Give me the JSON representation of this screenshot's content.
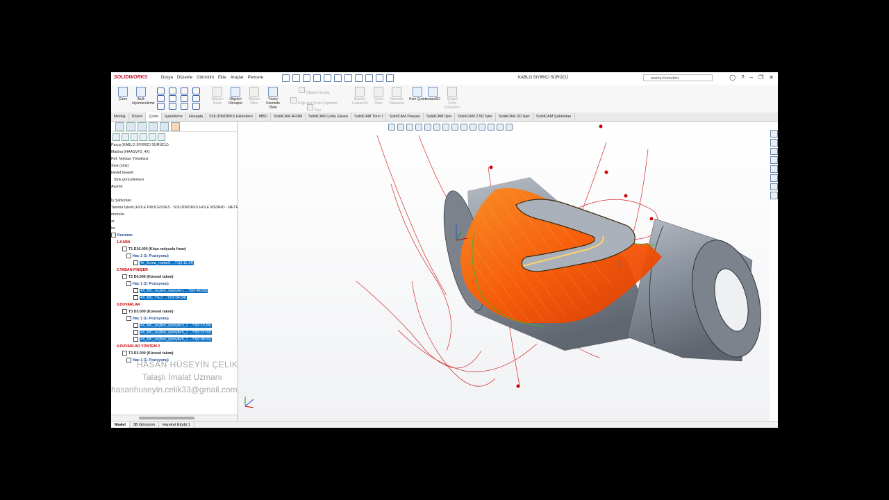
{
  "app": {
    "brand": "SOLIDWORKS",
    "document_title": "KABLO SIYIRICI SÜRÜCÜ",
    "search_placeholder": "arama Komutları",
    "menu": [
      "Dosya",
      "Düzenle",
      "Görünüm",
      "Ekle",
      "Araçlar",
      "Pencere"
    ]
  },
  "ribbon": {
    "items": [
      {
        "label": "Çizim",
        "enabled": true
      },
      {
        "label": "Akıllı ölçümlendirme",
        "enabled": true
      },
      {
        "label": "Objeleri Buda",
        "enabled": false
      },
      {
        "label": "Objeleri Dönüştür",
        "enabled": true
      },
      {
        "label": "Objeleri Ötele",
        "enabled": false
      },
      {
        "label": "Yüzey Üzerinde Ötele",
        "enabled": true
      },
      {
        "label": "Objeleri Aynala",
        "enabled": false
      },
      {
        "label": "Doğrusal Çizim Çoğaltma",
        "enabled": false
      },
      {
        "label": "Taşı",
        "enabled": false
      },
      {
        "label": "İlişkileri Göster/Sil",
        "enabled": false
      },
      {
        "label": "Çizimi Onar",
        "enabled": false
      },
      {
        "label": "Otomatik Yakalama",
        "enabled": false
      },
      {
        "label": "Hızlı Çizim",
        "enabled": true
      },
      {
        "label": "Instant2D",
        "enabled": true
      },
      {
        "label": "Gölgeli Çizim Konturları",
        "enabled": false
      }
    ]
  },
  "tabs": [
    "Montaj",
    "Düzen",
    "Çizim",
    "İşaretleme",
    "Hesapla",
    "SOLIDWORKS Eklentileri",
    "MBD",
    "SolidCAM AFRM",
    "SolidCAM Çoklu Eksen",
    "SolidCAM Tornा",
    "SolidCAM Parçası",
    "SolidCAM İşler",
    "SolidCAM 2.5D İşler",
    "SolidCAM 3D İşler",
    "SolidCAM Şablonları"
  ],
  "active_tab": "Çizim",
  "tree": [
    {
      "text": "Parça (KABLO SIYIRICI SÜRÜCÜ)",
      "style": "",
      "indent": 0
    },
    {
      "text": "Makina (HAASVF3_4X)",
      "style": "",
      "indent": 0
    },
    {
      "text": "Ref. Noktası Yöneticisi",
      "style": "",
      "indent": 0
    },
    {
      "text": "Stok (stok)",
      "style": "",
      "indent": 0
    },
    {
      "text": "Hedef (hedef)",
      "style": "",
      "indent": 0
    },
    {
      "text": "Stok güncellemesi",
      "style": "",
      "indent": 4
    },
    {
      "text": "Ayarlar",
      "style": "",
      "indent": 0
    },
    {
      "text": "",
      "style": "",
      "indent": 0
    },
    {
      "text": "İş Şablonları",
      "style": "",
      "indent": 0
    },
    {
      "text": "Tanıma İşlemi (HOLE PROCESSES - SOLIDWORKS HOLE WIZARD - METRIC)",
      "style": "",
      "indent": 0
    },
    {
      "text": "metreler",
      "style": "",
      "indent": 0
    },
    {
      "text": "ar",
      "style": "",
      "indent": 0
    },
    {
      "text": "ler",
      "style": "",
      "indent": 0
    },
    {
      "text": "Kurulum",
      "style": "blue",
      "indent": 0
    },
    {
      "text": "1.KABA",
      "style": "red",
      "indent": 8
    },
    {
      "text": "T1 D10.000  (Köşe radyuslu freze)",
      "style": "bold",
      "indent": 16
    },
    {
      "text": "Hac 1 (1- Pozisyonu)",
      "style": "blue",
      "indent": 22
    },
    {
      "text": "4x_Screw_model1 ...T1(0:11:14)",
      "style": "sel",
      "indent": 32
    },
    {
      "text": "2.TABAN FİNİŞER",
      "style": "red",
      "indent": 8
    },
    {
      "text": "T2 D6.000  (Küresel takım)",
      "style": "bold",
      "indent": 16
    },
    {
      "text": "Hac 1 (1- Pozisyonu)",
      "style": "blue",
      "indent": 22
    },
    {
      "text": "4X_MC_seçilen_yüzeyler1 ...T2(0:46:59)",
      "style": "sel",
      "indent": 32
    },
    {
      "text": "4X_MC_Yüz1 ...T2(0:04:34)",
      "style": "sel",
      "indent": 32
    },
    {
      "text": "3.DUVARLAR",
      "style": "red",
      "indent": 8
    },
    {
      "text": "T3 D3.000  (Küresel takım)",
      "style": "bold",
      "indent": 16
    },
    {
      "text": "Hac 1 (1- Pozisyonu)",
      "style": "blue",
      "indent": 22
    },
    {
      "text": "4X_MC_seçilen_yüzeyler3_1 ...T3(0:19:24)",
      "style": "sel",
      "indent": 32
    },
    {
      "text": "4X_MC_seçilen_yüzeyler5_1 ...T3(0:22:09)",
      "style": "sel",
      "indent": 32
    },
    {
      "text": "4X_MC_seçilen_yüzeyler6_1 ...T3(0:08:03)",
      "style": "sel",
      "indent": 32
    },
    {
      "text": "4.DUVARLAR YÖNTEM 2",
      "style": "red",
      "indent": 8
    },
    {
      "text": "T3 D3.000  (Küresel takım)",
      "style": "bold",
      "indent": 16
    },
    {
      "text": "Hac 1 (1- Pozisyonu)",
      "style": "blue",
      "indent": 22
    },
    {
      "text": "",
      "style": "",
      "indent": 32
    },
    {
      "text": "",
      "style": "",
      "indent": 32
    }
  ],
  "bottom_tabs": [
    "Model",
    "3B Görünüm",
    "Hareket Etüdü 1"
  ],
  "active_bottom_tab": "Model",
  "watermark": {
    "name": "HASAN HÜSEYİN ÇELİK",
    "title": "Talaşlı İmalat Uzmanı",
    "email": "hasanhuseyin.celik33@gmail.com"
  },
  "colors": {
    "toolpath": "#ff5a00",
    "part": "#8e96a3",
    "selection": "#0a6fc2",
    "brand": "#c8102e"
  }
}
